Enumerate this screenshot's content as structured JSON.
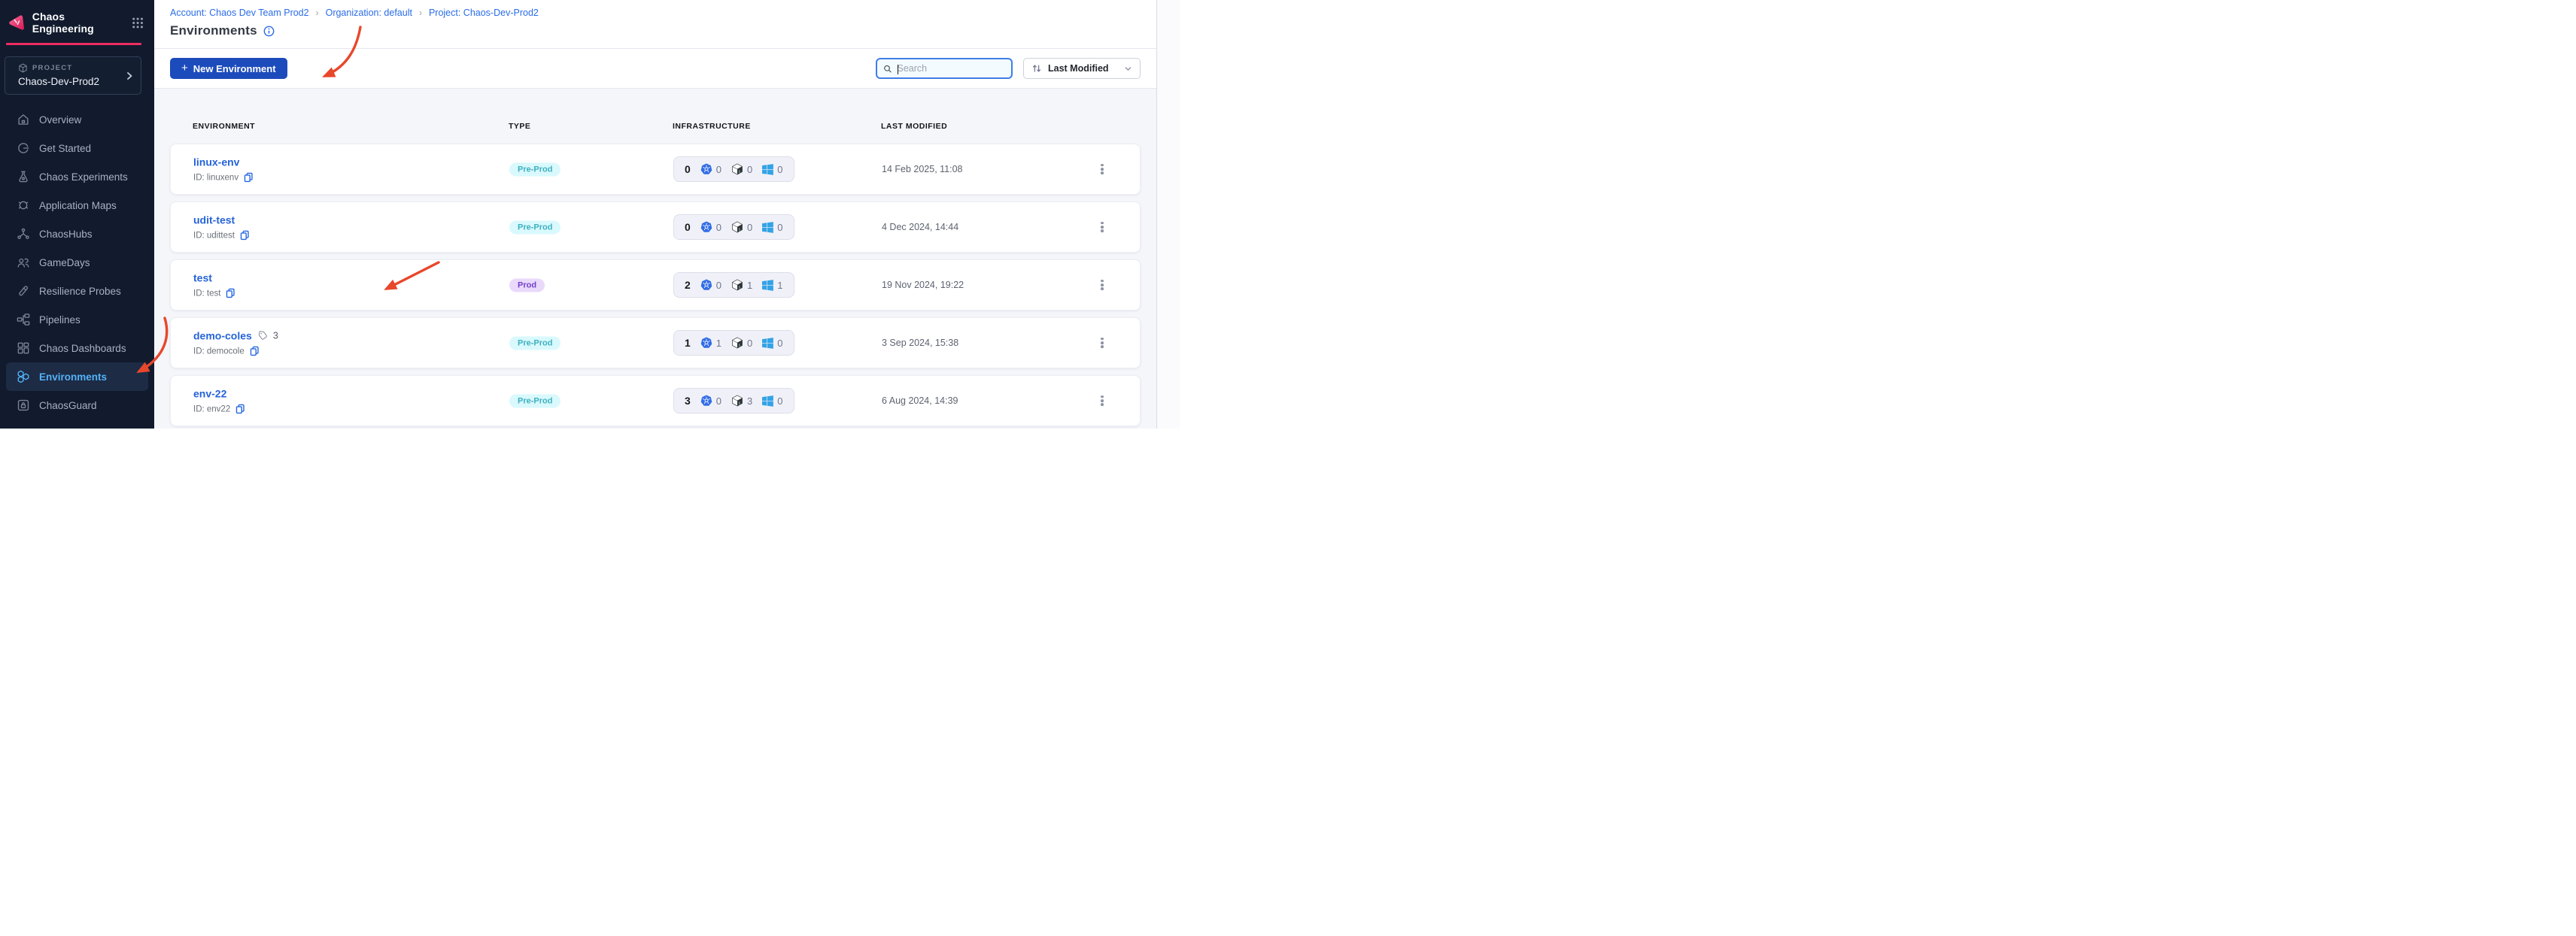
{
  "app": {
    "brand": "Chaos Engineering"
  },
  "sidebar": {
    "project_label": "PROJECT",
    "project_name": "Chaos-Dev-Prod2",
    "items": [
      {
        "label": "Overview",
        "icon": "home-icon",
        "active": false
      },
      {
        "label": "Get Started",
        "icon": "get-started-icon",
        "active": false
      },
      {
        "label": "Chaos Experiments",
        "icon": "flask-icon",
        "active": false
      },
      {
        "label": "Application Maps",
        "icon": "target-icon",
        "active": false
      },
      {
        "label": "ChaosHubs",
        "icon": "hub-icon",
        "active": false
      },
      {
        "label": "GameDays",
        "icon": "users-icon",
        "active": false
      },
      {
        "label": "Resilience Probes",
        "icon": "test-tube-icon",
        "active": false
      },
      {
        "label": "Pipelines",
        "icon": "pipeline-icon",
        "active": false
      },
      {
        "label": "Chaos Dashboards",
        "icon": "dashboard-icon",
        "active": false
      },
      {
        "label": "Environments",
        "icon": "hexagons-icon",
        "active": true
      },
      {
        "label": "ChaosGuard",
        "icon": "lock-icon",
        "active": false
      }
    ]
  },
  "breadcrumb": {
    "separator": "›",
    "items": [
      {
        "label": "Account: Chaos Dev Team Prod2"
      },
      {
        "label": "Organization: default"
      },
      {
        "label": "Project: Chaos-Dev-Prod2"
      }
    ]
  },
  "page": {
    "title": "Environments"
  },
  "toolbar": {
    "new_button": {
      "plus": "+",
      "label": "New Environment"
    },
    "search_placeholder": "Search",
    "sort_label": "Last Modified"
  },
  "table": {
    "columns": [
      "ENVIRONMENT",
      "TYPE",
      "INFRASTRUCTURE",
      "LAST MODIFIED"
    ],
    "rows": [
      {
        "name": "linux-env",
        "id": "ID: linuxenv",
        "type": "Pre-Prod",
        "infra": {
          "total": "0",
          "kubernetes": "0",
          "linux": "0",
          "windows": "0"
        },
        "modified": "14 Feb 2025, 11:08"
      },
      {
        "name": "udit-test",
        "id": "ID: udittest",
        "type": "Pre-Prod",
        "infra": {
          "total": "0",
          "kubernetes": "0",
          "linux": "0",
          "windows": "0"
        },
        "modified": "4 Dec 2024, 14:44"
      },
      {
        "name": "test",
        "id": "ID: test",
        "type": "Prod",
        "infra": {
          "total": "2",
          "kubernetes": "0",
          "linux": "1",
          "windows": "1"
        },
        "modified": "19 Nov 2024, 19:22"
      },
      {
        "name": "demo-coles",
        "id": "ID: democole",
        "tags_count": "3",
        "type": "Pre-Prod",
        "infra": {
          "total": "1",
          "kubernetes": "1",
          "linux": "0",
          "windows": "0"
        },
        "modified": "3 Sep 2024, 15:38"
      },
      {
        "name": "env-22",
        "id": "ID: env22",
        "type": "Pre-Prod",
        "infra": {
          "total": "3",
          "kubernetes": "0",
          "linux": "3",
          "windows": "0"
        },
        "modified": "6 Aug 2024, 14:39"
      }
    ]
  },
  "colors": {
    "accent_pink": "#ee2d62",
    "primary_blue": "#1c4bbc",
    "link_blue": "#2a6ce8",
    "sidebar_bg": "#111b2d",
    "active_nav_blue": "#54b2f8",
    "preprod_badge_bg": "#d9f9fd",
    "preprod_badge_text": "#3fb0c0",
    "prod_badge_bg": "#ead9fb",
    "prod_badge_text": "#7240c9",
    "annotation_red": "#e8472b"
  }
}
